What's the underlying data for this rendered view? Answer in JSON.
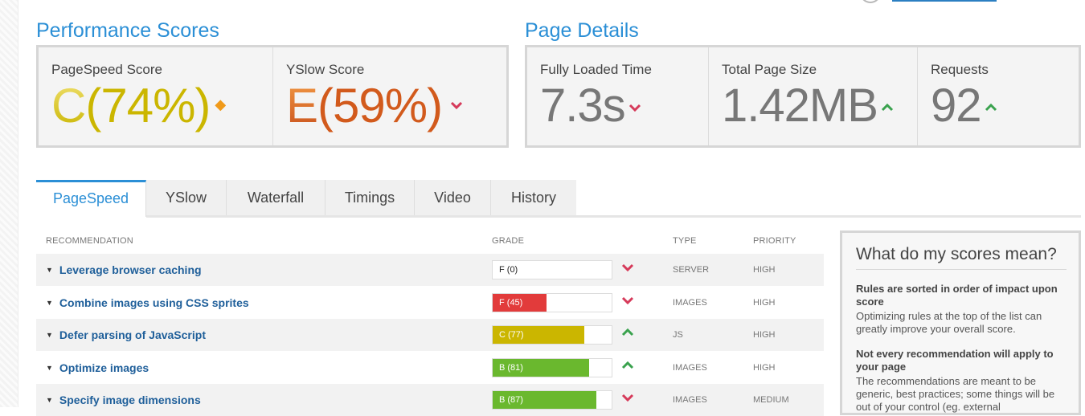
{
  "colors": {
    "accent": "#2b8fd6",
    "grade_c": "#cbb600",
    "grade_e": "#d25a1c",
    "bar_red": "#e23b3b",
    "bar_yellow": "#cbb600",
    "bar_green": "#6ab82e",
    "trend_down": "#d63a5a",
    "trend_up": "#3aa24e",
    "trend_neutral": "#f09a1a"
  },
  "performance": {
    "title": "Performance Scores",
    "pagespeed": {
      "label": "PageSpeed Score",
      "grade": "C",
      "percent": "(74%)",
      "trend_icon": "diamond-icon"
    },
    "yslow": {
      "label": "YSlow Score",
      "grade": "E",
      "percent": "(59%)",
      "trend_icon": "chevron-down-icon"
    }
  },
  "details": {
    "title": "Page Details",
    "loaded": {
      "label": "Fully Loaded Time",
      "value": "7.3s",
      "trend_icon": "chevron-down-icon"
    },
    "size": {
      "label": "Total Page Size",
      "value": "1.42MB",
      "trend_icon": "chevron-up-icon"
    },
    "requests": {
      "label": "Requests",
      "value": "92",
      "trend_icon": "chevron-up-icon"
    }
  },
  "tabs": [
    "PageSpeed",
    "YSlow",
    "Waterfall",
    "Timings",
    "Video",
    "History"
  ],
  "table": {
    "headers": {
      "recommendation": "RECOMMENDATION",
      "grade": "GRADE",
      "type": "TYPE",
      "priority": "PRIORITY"
    },
    "rows": [
      {
        "name": "Leverage browser caching",
        "grade": "F (0)",
        "score": 0,
        "trend": "down",
        "type": "SERVER",
        "priority": "HIGH"
      },
      {
        "name": "Combine images using CSS sprites",
        "grade": "F (45)",
        "score": 45,
        "trend": "down",
        "type": "IMAGES",
        "priority": "HIGH"
      },
      {
        "name": "Defer parsing of JavaScript",
        "grade": "C (77)",
        "score": 77,
        "trend": "up",
        "type": "JS",
        "priority": "HIGH"
      },
      {
        "name": "Optimize images",
        "grade": "B (81)",
        "score": 81,
        "trend": "up",
        "type": "IMAGES",
        "priority": "HIGH"
      },
      {
        "name": "Specify image dimensions",
        "grade": "B (87)",
        "score": 87,
        "trend": "down",
        "type": "IMAGES",
        "priority": "MEDIUM"
      }
    ]
  },
  "sidebar": {
    "title": "What do my scores mean?",
    "h1": "Rules are sorted in order of impact upon score",
    "p1": "Optimizing rules at the top of the list can greatly improve your overall score.",
    "h2": "Not every recommendation will apply to your page",
    "p2": "The recommendations are meant to be generic, best practices; some things will be out of your control (eg. external"
  }
}
